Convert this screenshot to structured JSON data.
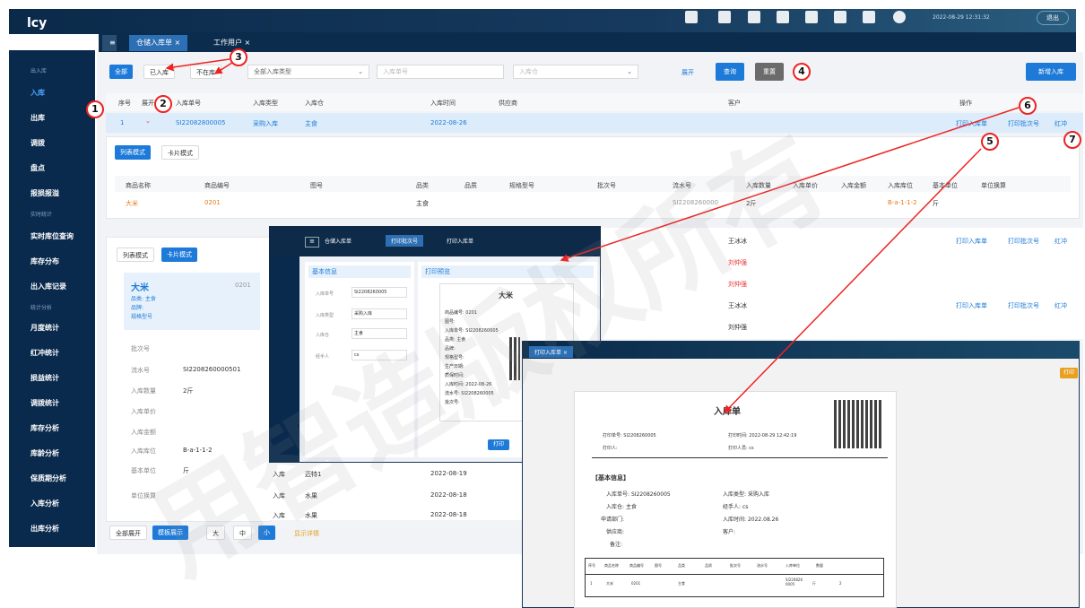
{
  "header": {
    "logo": "lcy",
    "datetime": "2022-08-29 12:31:32",
    "exit": "退出"
  },
  "tabs": [
    {
      "label": "仓储入库单"
    },
    {
      "label": "工作用户"
    }
  ],
  "sidebar": {
    "group1": "出入库",
    "items1": [
      "入库",
      "出库",
      "调拨",
      "盘点",
      "报损报溢"
    ],
    "group2": "实时统计",
    "items2": [
      "实时库位查询",
      "库存分布",
      "出入库记录"
    ],
    "group3": "统计分析",
    "items3": [
      "月度统计",
      "红冲统计",
      "损益统计",
      "调拨统计",
      "库存分析",
      "库龄分析",
      "保质期分析",
      "入库分析",
      "出库分析"
    ]
  },
  "toolbar": {
    "all": "全部",
    "in_stock": "已入库",
    "not_in": "不在库",
    "type_select": "全部入库类型",
    "order_placeholder": "入库单号",
    "warehouse_placeholder": "入库仓",
    "expand": "展开",
    "query": "查询",
    "reset": "重置",
    "new": "新增入库"
  },
  "table": {
    "headers": [
      "序号",
      "展开",
      "入库单号",
      "入库类型",
      "入库仓",
      "入库时间",
      "供应商",
      "客户",
      "操作"
    ],
    "row1": {
      "no": "1",
      "order": "SI22082800005",
      "type": "采购入库",
      "warehouse": "主食",
      "date": "2022-08-26"
    },
    "actions": [
      "打印入库单",
      "打印批次号",
      "红冲"
    ]
  },
  "detail": {
    "mode_list": "列表模式",
    "mode_card": "卡片模式",
    "headers": [
      "商品名称",
      "商品编号",
      "图号",
      "品类",
      "品质",
      "规格型号",
      "批次号",
      "流水号",
      "入库数量",
      "入库单价",
      "入库金额",
      "入库库位",
      "基本单位",
      "单位换算"
    ],
    "row": {
      "name": "大米",
      "code": "0201",
      "category": "主食",
      "serial": "SI2208260000",
      "qty": "2斤",
      "loc": "B-a-1-1-2",
      "unit": "斤"
    }
  },
  "other_rows": [
    {
      "customer": "王冰冰"
    },
    {
      "customer": "刘仲强"
    },
    {
      "customer": "刘仲强"
    },
    {
      "customer": "王冰冰"
    },
    {
      "customer": "刘仲强"
    }
  ],
  "card": {
    "mode_list": "列表模式",
    "mode_card": "卡片模式",
    "name": "大米",
    "code": "0201",
    "cat": "品类: 主食",
    "brand": "品牌:",
    "spec": "规格型号",
    "fields": [
      {
        "k": "批次号",
        "v": ""
      },
      {
        "k": "流水号",
        "v": "SI2208260000501"
      },
      {
        "k": "入库数量",
        "v": "2斤"
      },
      {
        "k": "入库单价",
        "v": ""
      },
      {
        "k": "入库金额",
        "v": ""
      },
      {
        "k": "入库库位",
        "v": "B-a-1-1-2"
      },
      {
        "k": "基本单位",
        "v": "斤"
      },
      {
        "k": "单位换算",
        "v": ""
      }
    ]
  },
  "footer": {
    "collapse_all": "全部展开",
    "view": "模板展示",
    "size": "大",
    "mid": "中",
    "small": "小",
    "hint": "显示详情"
  },
  "lower_rows": [
    {
      "type": "入库",
      "wh": "迈特1",
      "date": "2022-08-19"
    },
    {
      "type": "入库",
      "wh": "水果",
      "date": "2022-08-18"
    },
    {
      "type": "入库",
      "wh": "水果",
      "date": "2022-08-18"
    }
  ],
  "popup1": {
    "tabs": [
      "仓储入库单",
      "打印批次号",
      "打印入库单"
    ],
    "basic": "基本信息",
    "print": "打印预览",
    "fields": [
      {
        "k": "入库单号",
        "v": "SI2208260005"
      },
      {
        "k": "入库类型",
        "v": "采购入库"
      },
      {
        "k": "入库仓",
        "v": "主食"
      },
      {
        "k": "经手人",
        "v": "cs"
      }
    ],
    "label_title": "大米",
    "label_lines": [
      "商品编号: 0201",
      "图号:",
      "入库单号: SI2208260005",
      "品类: 主食",
      "品牌:",
      "规格型号:",
      "生产日期:",
      "质保时间:",
      "入库时间: 2022-08-26",
      "流水号: SI2208260005",
      "批次号:"
    ],
    "print_btn": "打印"
  },
  "popup2": {
    "tab": "打印入库单",
    "print_btn": "打印",
    "title": "入库单",
    "meta": [
      {
        "k": "打印单号:",
        "v": "SI2208260005"
      },
      {
        "k": "打印时间:",
        "v": "2022-08-29 12:42:19"
      },
      {
        "k": "打印人:",
        "v": ""
      },
      {
        "k": "打印人员:",
        "v": "cs"
      }
    ],
    "section": "【基本信息】",
    "info": [
      {
        "k": "入库单号:",
        "v": "SI2208260005"
      },
      {
        "k": "入库类型:",
        "v": "采购入库"
      },
      {
        "k": "入库仓:",
        "v": "主食"
      },
      {
        "k": "经手人:",
        "v": "cs"
      },
      {
        "k": "申请部门:",
        "v": ""
      },
      {
        "k": "入库时间:",
        "v": "2022.08.26"
      },
      {
        "k": "供应商:",
        "v": ""
      },
      {
        "k": "客户:",
        "v": ""
      },
      {
        "k": "备注:",
        "v": ""
      }
    ],
    "th": [
      "序号",
      "商品名称",
      "商品编号",
      "图号",
      "品类",
      "品质",
      "批次号",
      "流水号",
      "入库单位",
      "数量"
    ],
    "tr": [
      "1",
      "大米",
      "0201",
      "",
      "主食",
      "",
      "",
      "SI2208260005",
      "斤",
      "2"
    ]
  },
  "markers": [
    "1",
    "2",
    "3",
    "4",
    "5",
    "6",
    "7"
  ],
  "watermark": "用智造版权所有"
}
